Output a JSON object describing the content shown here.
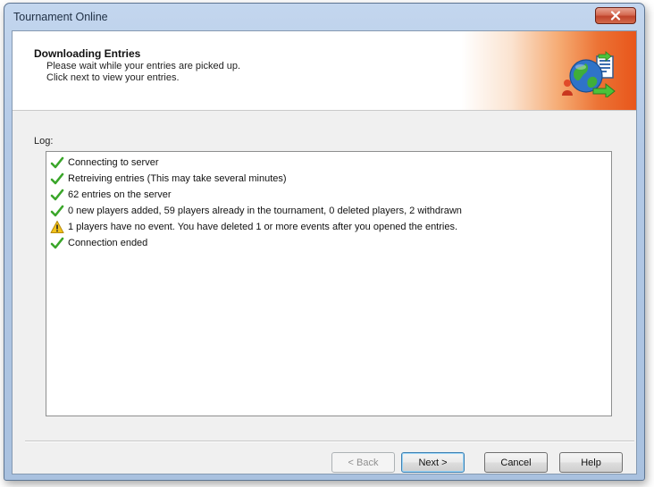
{
  "window": {
    "title": "Tournament Online"
  },
  "header": {
    "title": "Downloading Entries",
    "subtitle_line1": "Please wait while your entries are picked up.",
    "subtitle_line2": "Click next to view your entries.",
    "icon": "globe-transfer-icon"
  },
  "log": {
    "label": "Log:",
    "entries": [
      {
        "status": "success",
        "icon": "green-check-icon",
        "text": "Connecting to server"
      },
      {
        "status": "success",
        "icon": "green-check-icon",
        "text": "Retreiving entries (This may take several minutes)"
      },
      {
        "status": "success",
        "icon": "green-check-icon",
        "text": "62 entries on the server"
      },
      {
        "status": "success",
        "icon": "green-check-icon",
        "text": "0 new players added, 59 players already in the tournament, 0 deleted players, 2 withdrawn"
      },
      {
        "status": "warning",
        "icon": "warning-icon",
        "text": "1 players have no event. You have deleted 1 or more events after you opened the entries."
      },
      {
        "status": "success",
        "icon": "green-check-icon",
        "text": "Connection ended"
      }
    ]
  },
  "buttons": {
    "back": "< Back",
    "next": "Next >",
    "cancel": "Cancel",
    "help": "Help"
  },
  "colors": {
    "header_accent": "#e8561b",
    "success": "#3aa62a",
    "warning": "#f2c21b",
    "close_button": "#c0432b"
  }
}
